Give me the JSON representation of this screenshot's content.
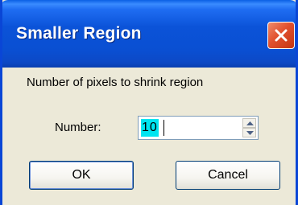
{
  "window": {
    "title": "Smaller Region"
  },
  "dialog": {
    "prompt": "Number of pixels to shrink region",
    "number_label": "Number:",
    "number_value": "10"
  },
  "buttons": {
    "ok_label": "OK",
    "cancel_label": "Cancel"
  },
  "icons": {
    "close": "close-icon",
    "spin_up": "spin-up-arrow-icon",
    "spin_down": "spin-down-arrow-icon"
  },
  "colors": {
    "titlebar": "#0a53d8",
    "close_button": "#e1502e",
    "selection": "#00e5f0",
    "dialog_background": "#ece9d8"
  }
}
